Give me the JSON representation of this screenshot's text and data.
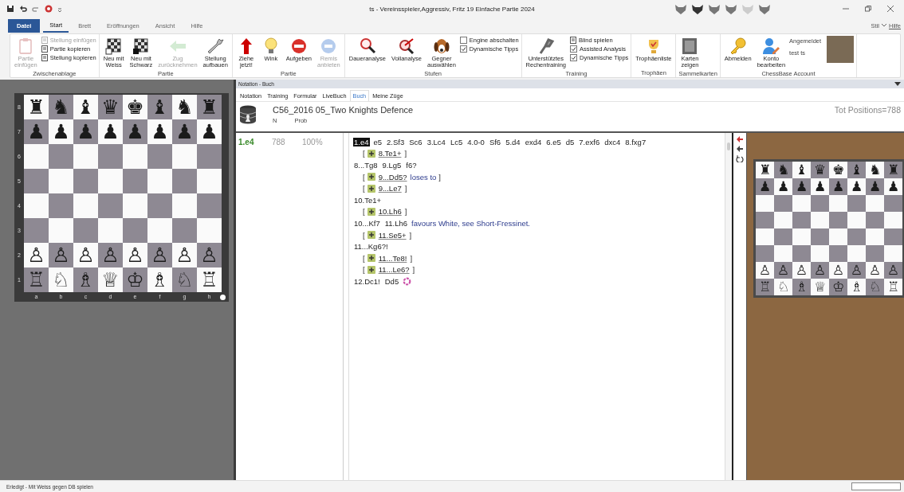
{
  "title_bar": {
    "title": "ts - Vereinsspieler,Aggressiv, Fritz 19 Einfache Partie 2024"
  },
  "ribbon": {
    "tabs": [
      {
        "label": "Datei",
        "kind": "file",
        "selected": false
      },
      {
        "label": "Start",
        "kind": "tab",
        "selected": true
      },
      {
        "label": "Brett",
        "kind": "tab",
        "selected": false
      },
      {
        "label": "Eröffnungen",
        "kind": "tab",
        "selected": false
      },
      {
        "label": "Ansicht",
        "kind": "tab",
        "selected": false
      },
      {
        "label": "Hilfe",
        "kind": "tab",
        "selected": false
      }
    ],
    "right_links": [
      "Stil",
      "Hilfe"
    ],
    "groups": [
      {
        "label": "Zwischenablage",
        "items": [
          {
            "kind": "large",
            "label": "Partie\neinfügen",
            "disabled": true
          },
          {
            "kind": "stack",
            "entries": [
              {
                "kind": "small",
                "label": "Stellung einfügen",
                "disabled": true
              },
              {
                "kind": "small",
                "label": "Partie kopieren",
                "disabled": false
              },
              {
                "kind": "small",
                "label": "Stellung kopieren",
                "disabled": false
              }
            ]
          }
        ]
      },
      {
        "label": "Partie",
        "items": [
          {
            "kind": "large",
            "label": "Neu mit\nWeiss",
            "disabled": false
          },
          {
            "kind": "large",
            "label": "Neu mit\nSchwarz",
            "disabled": false
          },
          {
            "kind": "large",
            "label": "Zug\nzurücknehmen",
            "disabled": true
          },
          {
            "kind": "large",
            "label": "Stellung\naufbauen",
            "disabled": false
          }
        ]
      },
      {
        "label": "Partie",
        "items": [
          {
            "kind": "large",
            "label": "Ziehe\njetzt!",
            "disabled": false
          },
          {
            "kind": "large",
            "label": "Wink",
            "disabled": false
          },
          {
            "kind": "large",
            "label": "Aufgeben",
            "disabled": false
          },
          {
            "kind": "large",
            "label": "Remis\nanbieten",
            "disabled": true
          }
        ]
      },
      {
        "label": "Stufen",
        "items": [
          {
            "kind": "large",
            "label": "Daueranalyse",
            "disabled": false
          },
          {
            "kind": "large",
            "label": "Vollanalyse",
            "disabled": false
          },
          {
            "kind": "large",
            "label": "Gegner\nauswählen",
            "disabled": false
          },
          {
            "kind": "stack",
            "entries": [
              {
                "kind": "check",
                "label": "Engine abschalten",
                "checked": false,
                "disabled": false
              },
              {
                "kind": "check",
                "label": "Dynamische Tipps",
                "checked": true,
                "disabled": false
              }
            ]
          }
        ]
      },
      {
        "label": "Training",
        "items": [
          {
            "kind": "large",
            "label": "Unterstütztes\nRechentraining",
            "disabled": false
          },
          {
            "kind": "stack",
            "entries": [
              {
                "kind": "small",
                "label": "Blind spielen",
                "disabled": false
              },
              {
                "kind": "check",
                "label": "Assisted Analysis",
                "checked": true,
                "disabled": false
              },
              {
                "kind": "check",
                "label": "Dynamische Tipps",
                "checked": true,
                "disabled": false
              }
            ]
          }
        ]
      },
      {
        "label": "Trophäen",
        "items": [
          {
            "kind": "large",
            "label": "Trophäenliste",
            "disabled": false
          }
        ]
      },
      {
        "label": "Sammelkarten",
        "items": [
          {
            "kind": "large",
            "label": "Karten\nzeigen",
            "disabled": false
          }
        ]
      },
      {
        "label": "ChessBase Account",
        "items": [
          {
            "kind": "large",
            "label": "Abmelden",
            "disabled": false
          },
          {
            "kind": "large",
            "label": "Konto\nbearbeiten",
            "disabled": false
          },
          {
            "kind": "stack",
            "entries": [
              {
                "kind": "text",
                "label": "Angemeldet",
                "disabled": false
              },
              {
                "kind": "text",
                "label": "test ts",
                "disabled": false
              }
            ]
          },
          {
            "kind": "photo",
            "disabled": false
          }
        ]
      }
    ]
  },
  "boards": [
    {
      "kind": "main",
      "rank_labels": [
        "8",
        "7",
        "6",
        "5",
        "4",
        "3",
        "2",
        "1"
      ],
      "file_labels": [
        "a",
        "b",
        "c",
        "d",
        "e",
        "f",
        "g",
        "h"
      ],
      "ranks": [
        {
          "kind": "pieces",
          "pieces": [
            "♜",
            "♞",
            "♝",
            "♛",
            "♚",
            "♝",
            "♞",
            "♜"
          ]
        },
        {
          "kind": "pieces",
          "pieces": [
            "♟",
            "♟",
            "♟",
            "♟",
            "♟",
            "♟",
            "♟",
            "♟"
          ]
        },
        {
          "kind": "empty"
        },
        {
          "kind": "empty"
        },
        {
          "kind": "empty"
        },
        {
          "kind": "empty"
        },
        {
          "kind": "pieces",
          "pieces": [
            "♙",
            "♙",
            "♙",
            "♙",
            "♙",
            "♙",
            "♙",
            "♙"
          ]
        },
        {
          "kind": "pieces",
          "pieces": [
            "♖",
            "♘",
            "♗",
            "♕",
            "♔",
            "♗",
            "♘",
            "♖"
          ]
        }
      ]
    },
    {
      "kind": "mini",
      "ranks": [
        {
          "kind": "pieces",
          "pieces": [
            "♜",
            "♞",
            "♝",
            "♛",
            "♚",
            "♝",
            "♞",
            "♜"
          ]
        },
        {
          "kind": "pieces",
          "pieces": [
            "♟",
            "♟",
            "♟",
            "♟",
            "♟",
            "♟",
            "♟",
            "♟"
          ]
        },
        {
          "kind": "empty"
        },
        {
          "kind": "empty"
        },
        {
          "kind": "empty"
        },
        {
          "kind": "empty"
        },
        {
          "kind": "pieces",
          "pieces": [
            "♙",
            "♙",
            "♙",
            "♙",
            "♙",
            "♙",
            "♙",
            "♙"
          ]
        },
        {
          "kind": "pieces",
          "pieces": [
            "♖",
            "♘",
            "♗",
            "♕",
            "♔",
            "♗",
            "♘",
            "♖"
          ]
        }
      ]
    }
  ],
  "notation_panel": {
    "title": "Notation - Buch",
    "tabs": [
      {
        "label": "Notation",
        "selected": false
      },
      {
        "label": "Training",
        "selected": false
      },
      {
        "label": "Formular",
        "selected": false
      },
      {
        "label": "LiveBuch",
        "selected": false
      },
      {
        "label": "Buch",
        "selected": true
      },
      {
        "label": "Meine Züge",
        "selected": false
      }
    ],
    "book": {
      "title": "C56_2016 05_Two Knights Defence",
      "total": "Tot Positions=788",
      "columns": [
        "N",
        "Prob"
      ],
      "rows": [
        {
          "move": "1.e4",
          "n": "788",
          "prob": "100%"
        }
      ]
    },
    "lines": [
      {
        "kind": "main",
        "moves": [
          {
            "text": "1.e4",
            "current": true
          },
          {
            "text": "e5",
            "current": false
          },
          {
            "text": "2.Sf3",
            "current": false
          },
          {
            "text": "Sc6",
            "current": false
          },
          {
            "text": "3.Lc4",
            "current": false
          },
          {
            "text": "Lc5",
            "current": false
          },
          {
            "text": "4.0-0",
            "current": false
          },
          {
            "text": "Sf6",
            "current": false
          },
          {
            "text": "5.d4",
            "current": false
          },
          {
            "text": "exd4",
            "current": false
          },
          {
            "text": "6.e5",
            "current": false
          },
          {
            "text": "d5",
            "current": false
          },
          {
            "text": "7.exf6",
            "current": false
          },
          {
            "text": "dxc4",
            "current": false
          },
          {
            "text": "8.fxg7",
            "current": false
          }
        ],
        "end_marker": false
      },
      {
        "kind": "variation",
        "open": "[",
        "moves": [
          {
            "text": "8.Te1+",
            "current": false
          }
        ],
        "close": "]"
      },
      {
        "kind": "main",
        "moves": [
          {
            "text": "8...Tg8",
            "current": false
          },
          {
            "text": "9.Lg5",
            "current": false
          },
          {
            "text": "f6?",
            "current": false
          }
        ],
        "end_marker": false
      },
      {
        "kind": "variation",
        "open": "[",
        "moves": [
          {
            "text": "9...Dd5?",
            "current": false
          }
        ],
        "comment": "loses to",
        "close": "]"
      },
      {
        "kind": "variation",
        "open": "[",
        "moves": [
          {
            "text": "9...Le7",
            "current": false
          }
        ],
        "close": "]"
      },
      {
        "kind": "main",
        "moves": [
          {
            "text": "10.Te1+",
            "current": false
          }
        ],
        "end_marker": false
      },
      {
        "kind": "variation",
        "open": "[",
        "moves": [
          {
            "text": "10.Lh6",
            "current": false
          }
        ],
        "close": "]"
      },
      {
        "kind": "main",
        "moves": [
          {
            "text": "10...Kf7",
            "current": false
          },
          {
            "text": "11.Lh6",
            "current": false
          }
        ],
        "comment": "favours White, see Short-Fressinet.",
        "end_marker": false
      },
      {
        "kind": "variation",
        "open": "[",
        "moves": [
          {
            "text": "11.Se5+",
            "current": false
          }
        ],
        "close": "]"
      },
      {
        "kind": "main",
        "moves": [
          {
            "text": "11...Kg6?!",
            "current": false
          }
        ],
        "end_marker": false
      },
      {
        "kind": "variation",
        "open": "[",
        "moves": [
          {
            "text": "11...Te8!",
            "current": false
          }
        ],
        "close": "]"
      },
      {
        "kind": "variation",
        "open": "[",
        "moves": [
          {
            "text": "11...Le6?",
            "current": false
          }
        ],
        "close": "]"
      },
      {
        "kind": "main",
        "moves": [
          {
            "text": "12.Dc1!",
            "current": false
          },
          {
            "text": "Dd5",
            "current": false
          }
        ],
        "end_marker": true
      }
    ]
  },
  "status_bar": {
    "text": "Erledigt - Mit Weiss gegen DB spielen"
  }
}
